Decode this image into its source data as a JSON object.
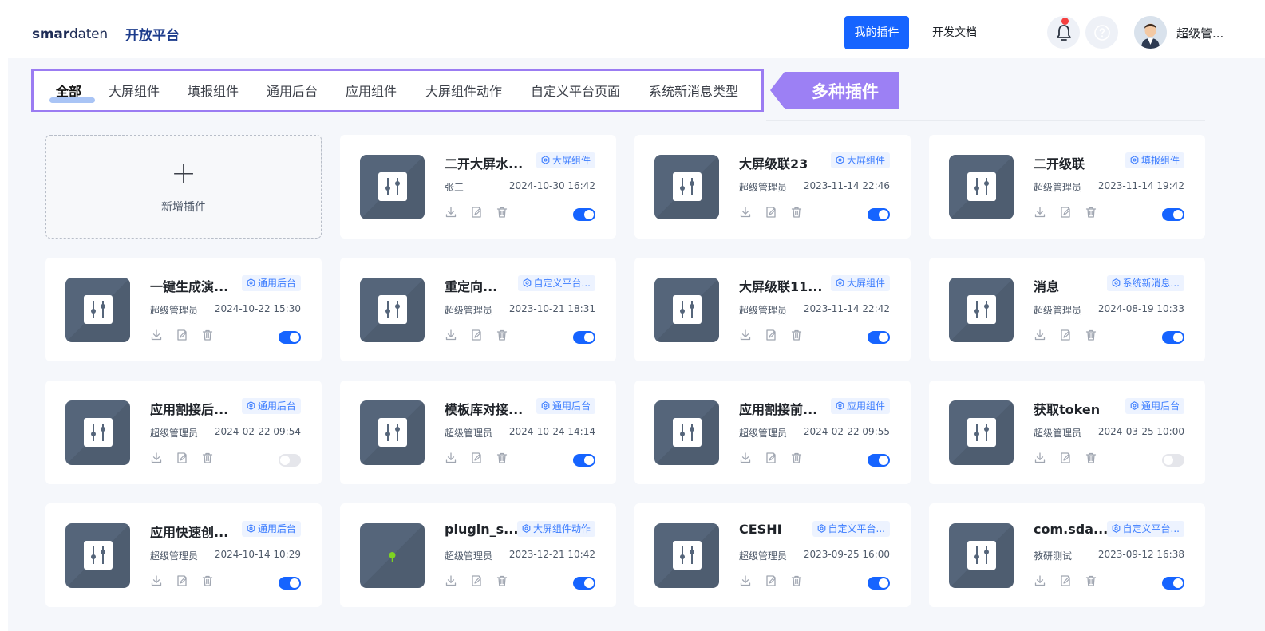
{
  "header": {
    "logo": {
      "bold": "smar",
      "light": "daten",
      "title": "开放平台"
    },
    "nav": [
      {
        "label": "我的插件",
        "active": true
      },
      {
        "label": "开发文档",
        "active": false
      }
    ],
    "username": "超级管...",
    "accent": "#1664ff"
  },
  "tabs": [
    "全部",
    "大屏组件",
    "填报组件",
    "通用后台",
    "应用组件",
    "大屏组件动作",
    "自定义平台页面",
    "系统新消息类型"
  ],
  "active_tab": "全部",
  "callout": "多种插件",
  "add_card": {
    "label": "新增插件"
  },
  "cards": [
    {
      "name": "二开大屏水...",
      "tag": "大屏组件",
      "author": "张三",
      "time": "2024-10-30 16:42",
      "enabled": true,
      "icon": "sliders-icon"
    },
    {
      "name": "大屏级联23",
      "tag": "大屏组件",
      "author": "超级管理员",
      "time": "2023-11-14 22:46",
      "enabled": true,
      "icon": "sliders-icon"
    },
    {
      "name": "二开级联",
      "tag": "填报组件",
      "author": "超级管理员",
      "time": "2023-11-14 19:42",
      "enabled": true,
      "icon": "sliders-icon"
    },
    {
      "name": "一键生成演...",
      "tag": "通用后台",
      "author": "超级管理员",
      "time": "2024-10-22 15:30",
      "enabled": true,
      "icon": "sliders-icon"
    },
    {
      "name": "重定向...",
      "tag": "自定义平台...",
      "author": "超级管理员",
      "time": "2023-10-21 18:31",
      "enabled": true,
      "icon": "sliders-icon"
    },
    {
      "name": "大屏级联11...",
      "tag": "大屏组件",
      "author": "超级管理员",
      "time": "2023-11-14 22:42",
      "enabled": true,
      "icon": "sliders-icon"
    },
    {
      "name": "消息",
      "tag": "系统新消息...",
      "author": "超级管理员",
      "time": "2024-08-19 10:33",
      "enabled": true,
      "icon": "sliders-icon"
    },
    {
      "name": "应用割接后...",
      "tag": "通用后台",
      "author": "超级管理员",
      "time": "2024-02-22 09:54",
      "enabled": false,
      "icon": "sliders-icon"
    },
    {
      "name": "模板库对接...",
      "tag": "通用后台",
      "author": "超级管理员",
      "time": "2024-10-24 14:14",
      "enabled": true,
      "icon": "sliders-icon"
    },
    {
      "name": "应用割接前...",
      "tag": "应用组件",
      "author": "超级管理员",
      "time": "2024-02-22 09:55",
      "enabled": true,
      "icon": "sliders-icon"
    },
    {
      "name": "获取token",
      "tag": "通用后台",
      "author": "超级管理员",
      "time": "2024-03-25 10:00",
      "enabled": false,
      "icon": "sliders-icon"
    },
    {
      "name": "应用快速创...",
      "tag": "通用后台",
      "author": "超级管理员",
      "time": "2024-10-14 10:29",
      "enabled": true,
      "icon": "sliders-icon"
    },
    {
      "name": "plugin_s...",
      "tag": "大屏组件动作",
      "author": "超级管理员",
      "time": "2023-12-21 10:42",
      "enabled": true,
      "icon": "pin-icon"
    },
    {
      "name": "CESHI",
      "tag": "自定义平台...",
      "author": "超级管理员",
      "time": "2023-09-25 16:00",
      "enabled": true,
      "icon": "sliders-icon"
    },
    {
      "name": "com.sda...",
      "tag": "自定义平台...",
      "author": "教研测试",
      "time": "2023-09-12 16:38",
      "enabled": true,
      "icon": "sliders-icon"
    }
  ]
}
